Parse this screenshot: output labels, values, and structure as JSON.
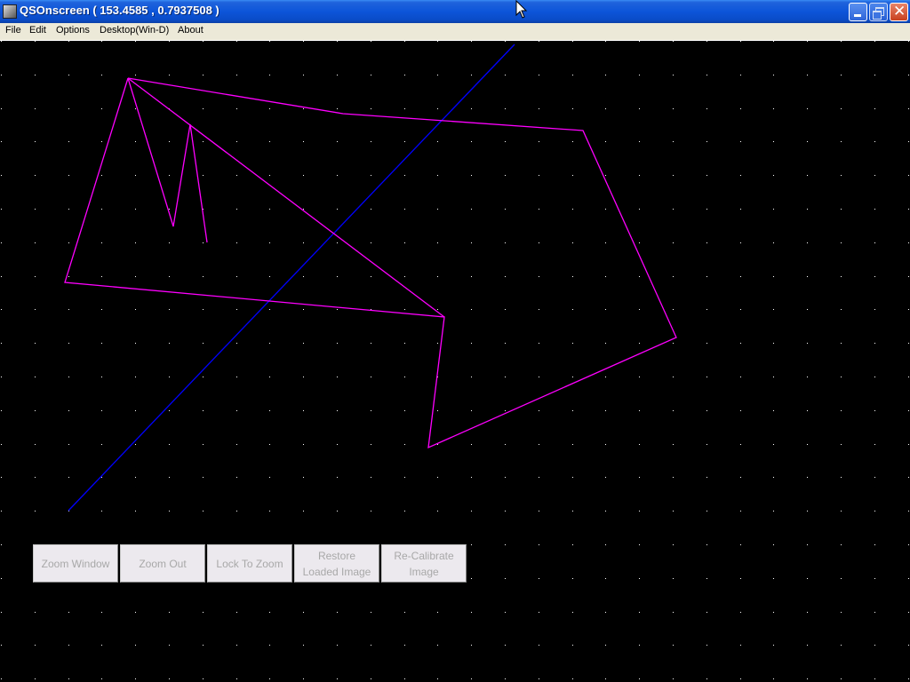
{
  "window": {
    "title": "QSOnscreen ( 153.4585 , 0.7937508 )",
    "controls": [
      "minimize",
      "restore",
      "close"
    ]
  },
  "menu": [
    {
      "label": "File"
    },
    {
      "label": "Edit"
    },
    {
      "label": "Options"
    },
    {
      "label": "Desktop(Win-D)"
    },
    {
      "label": "About"
    }
  ],
  "canvas": {
    "background": "#000000",
    "grid_dot_color": "#ffffff",
    "polyline_color": "#ff00ff",
    "calibration_line_color": "#0000ff"
  },
  "buttons": [
    {
      "label": "Zoom Window",
      "enabled": false
    },
    {
      "label": "Zoom Out",
      "enabled": false
    },
    {
      "label": "Lock To Zoom",
      "enabled": false
    },
    {
      "label": "Restore\nLoaded Image",
      "enabled": false
    },
    {
      "label": "Re-Calibrate\nImage",
      "enabled": false
    }
  ]
}
